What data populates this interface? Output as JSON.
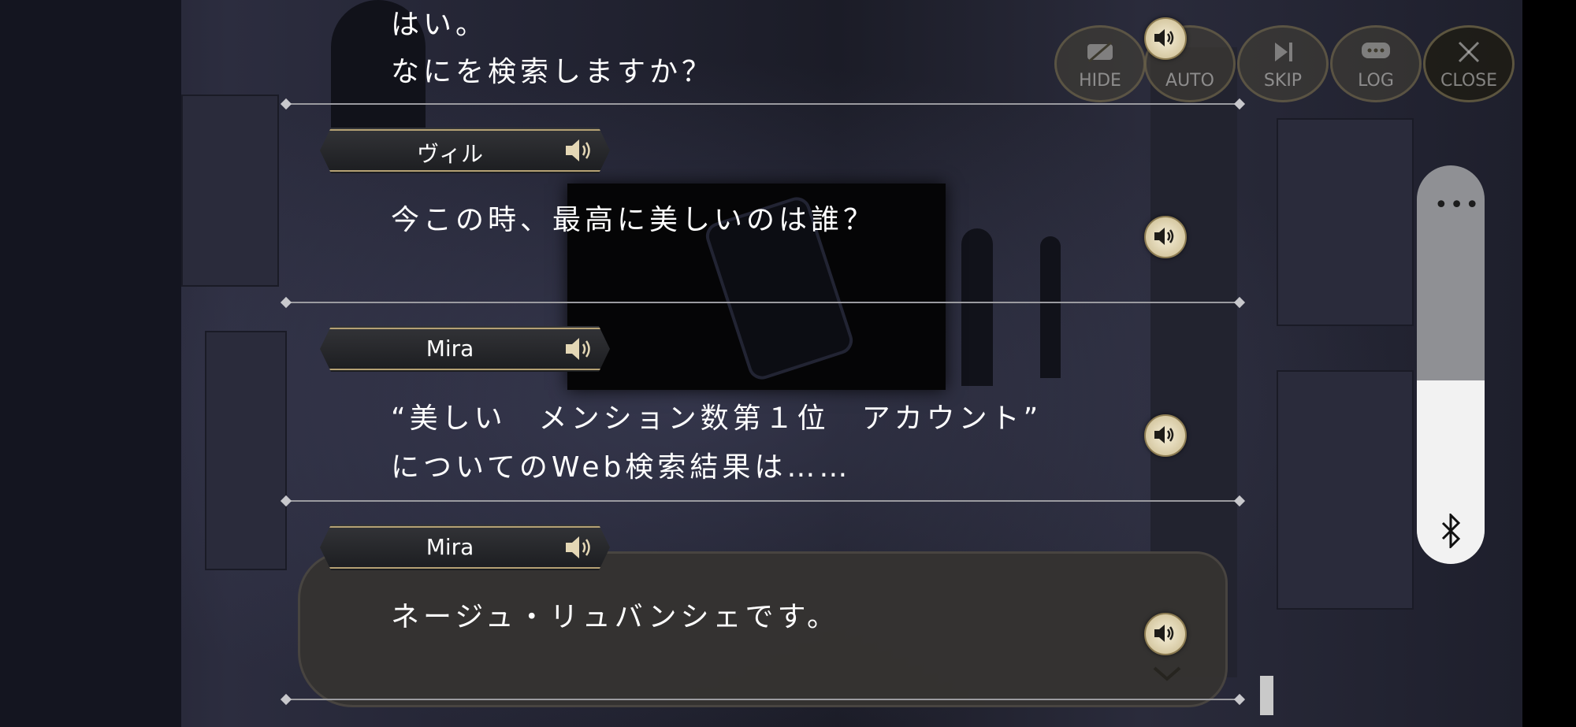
{
  "controls": [
    {
      "key": "hide",
      "label": "HIDE",
      "icon": "hide-icon"
    },
    {
      "key": "auto",
      "label": "AUTO",
      "icon": "auto-icon"
    },
    {
      "key": "skip",
      "label": "SKIP",
      "icon": "skip-icon"
    },
    {
      "key": "log",
      "label": "LOG",
      "icon": "log-icon"
    },
    {
      "key": "close",
      "label": "CLOSE",
      "icon": "close-icon"
    }
  ],
  "log": {
    "entries": [
      {
        "speaker": "",
        "lines": [
          "はい。",
          "なにを検索しますか？"
        ]
      },
      {
        "speaker": "ヴィル",
        "lines": [
          "今この時、最高に美しいのは誰？"
        ]
      },
      {
        "speaker": "Mira",
        "lines": [
          "“美しい　メンション数第１位　アカウント”",
          "についてのWeb検索結果は……"
        ]
      },
      {
        "speaker": "Mira",
        "lines": [
          "ネージュ・リュバンシェです。"
        ]
      }
    ]
  },
  "side_panel": {
    "icon": "bluetooth-icon",
    "menu_icon": "more-dots-icon",
    "more_dots": "•••",
    "level": 0.46
  },
  "colors": {
    "accent_gold": "#b5a174",
    "text": "#ffffff",
    "rail": "#9b9ba0"
  }
}
